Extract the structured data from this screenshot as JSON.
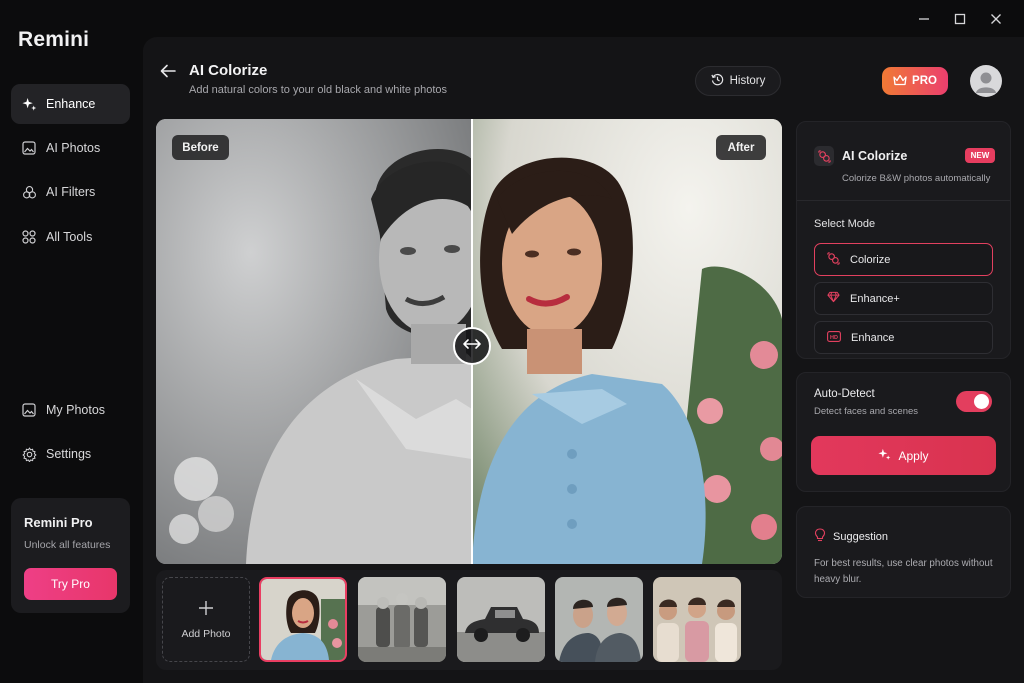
{
  "app": {
    "brand": "Remini"
  },
  "sidebar": {
    "items": [
      {
        "label": "Enhance",
        "icon": "sparkle-icon",
        "active": true
      },
      {
        "label": "AI Photos",
        "icon": "image-icon"
      },
      {
        "label": "AI Filters",
        "icon": "filters-icon"
      },
      {
        "label": "All Tools",
        "icon": "grid-icon"
      },
      {
        "label": "My Photos",
        "icon": "image-icon"
      },
      {
        "label": "Settings",
        "icon": "gear-icon"
      }
    ],
    "promo": {
      "title": "Remini Pro",
      "subtitle": "Unlock all features",
      "button": "Try Pro"
    }
  },
  "header": {
    "title": "AI Colorize",
    "subtitle": "Add natural colors to your old black and white photos",
    "history_label": "History",
    "pro_label": "PRO"
  },
  "compare": {
    "before_label": "Before",
    "after_label": "After"
  },
  "thumbnails": {
    "add_label": "Add Photo"
  },
  "feature": {
    "title": "AI Colorize",
    "badge": "NEW",
    "subtitle": "Colorize B&W photos automatically",
    "select_mode_label": "Select Mode",
    "modes": [
      {
        "label": "Colorize",
        "icon": "colorize-icon",
        "active": true
      },
      {
        "label": "Enhance+",
        "icon": "diamond-icon"
      },
      {
        "label": "Enhance",
        "icon": "hd-icon"
      }
    ]
  },
  "auto_detect": {
    "title": "Auto-Detect",
    "subtitle": "Detect faces and scenes",
    "enabled": true,
    "apply_label": "Apply"
  },
  "suggestion": {
    "title": "Suggestion",
    "text": "For best results, use clear photos without heavy blur."
  },
  "colors": {
    "accent": "#e2385c",
    "pro_gradient_start": "#f07a35",
    "panel": "#1a1a1d"
  }
}
